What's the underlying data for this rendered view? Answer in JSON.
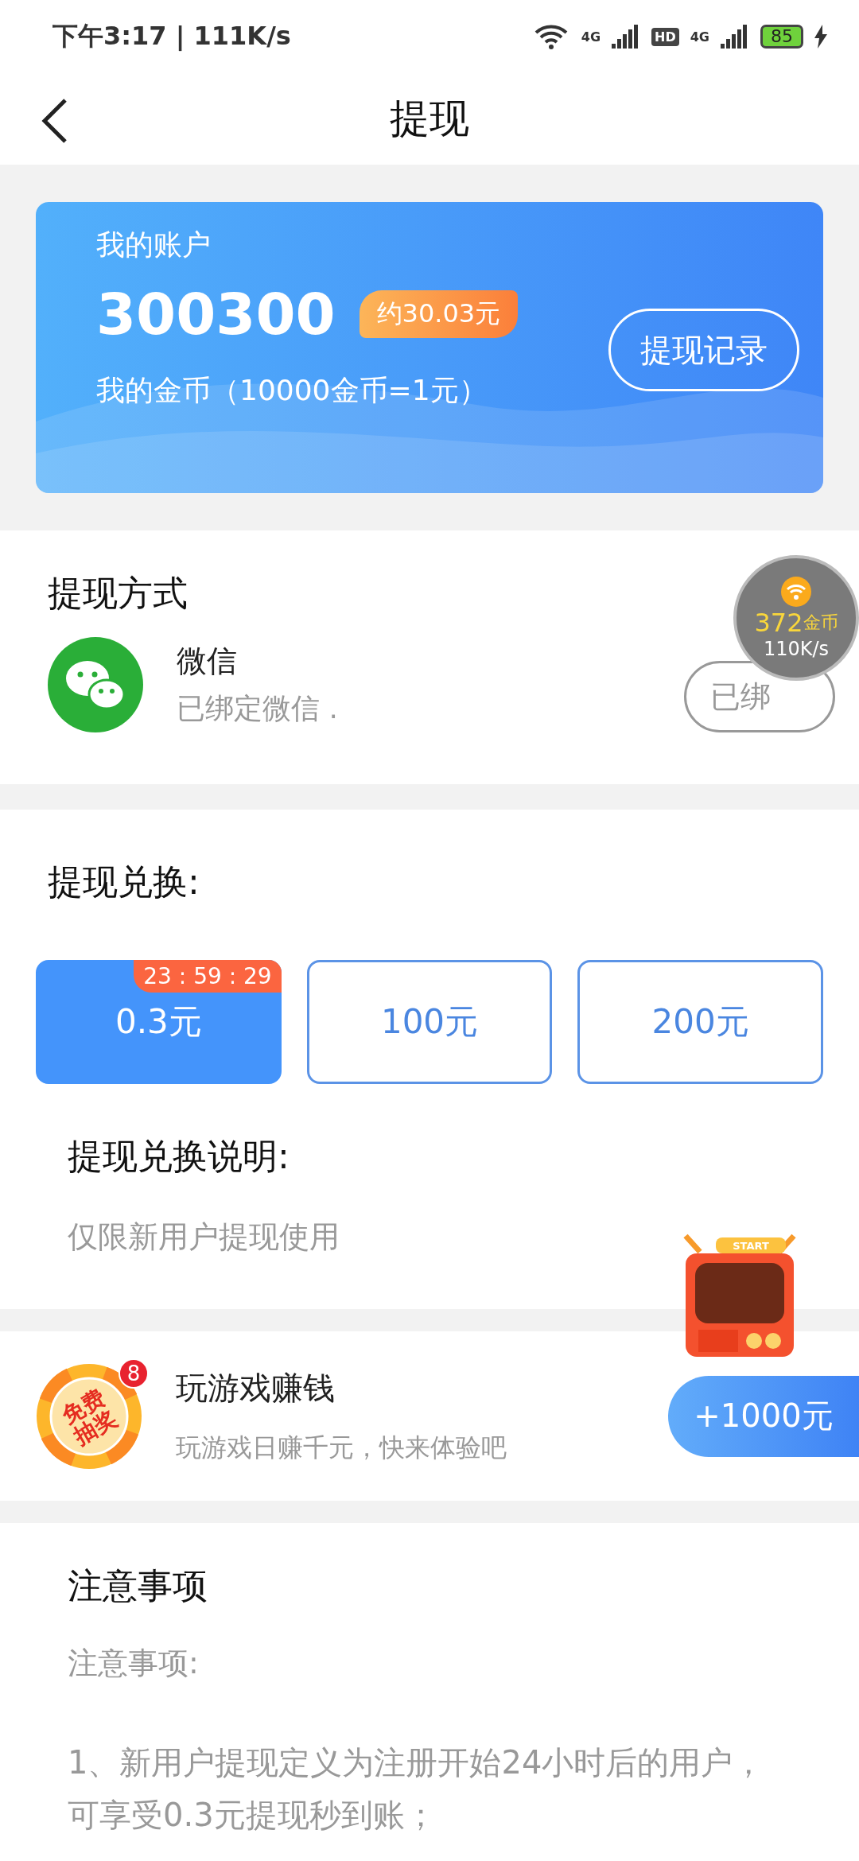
{
  "status_bar": {
    "time": "下午3:17 | 111K/s",
    "network_1": "4G",
    "hd": "HD",
    "network_2": "4G",
    "battery": "85"
  },
  "header": {
    "title": "提现"
  },
  "account": {
    "label": "我的账户",
    "coins": "300300",
    "approx": "约30.03元",
    "rate": "我的金币（10000金币=1元）",
    "records_button": "提现记录"
  },
  "method": {
    "title": "提现方式",
    "items": [
      {
        "name": "微信",
        "status": "已绑定微信 .",
        "button": "已绑"
      }
    ]
  },
  "exchange": {
    "title": "提现兑换:",
    "options": [
      {
        "amount": "0.3元",
        "selected": true,
        "timer": "23 : 59 : 29"
      },
      {
        "amount": "100元",
        "selected": false
      },
      {
        "amount": "200元",
        "selected": false
      }
    ],
    "note_title": "提现兑换说明:",
    "note": "仅限新用户提现使用"
  },
  "promo": {
    "badge_text": "免费抽奖",
    "badge_count": "8",
    "title": "玩游戏赚钱",
    "subtitle": "玩游戏日赚千元，快来体验吧",
    "button": "+1000元"
  },
  "notice": {
    "title": "注意事项",
    "subtitle": "注意事项:",
    "items": [
      "1、新用户提现定义为注册开始24小时后的用户，可享受0.3元提现秒到账；"
    ]
  },
  "floating_widget": {
    "coins": "372",
    "unit": "金币",
    "speed": "110K/s"
  },
  "tv_ad": {
    "label": "START"
  }
}
